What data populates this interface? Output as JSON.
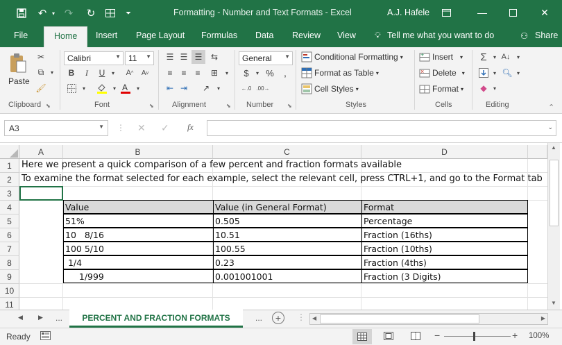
{
  "title_bar": {
    "document_title": "Formatting - Number and Text Formats  -  Excel",
    "user": "A.J. Hafele"
  },
  "ribbon_tabs": [
    "File",
    "Home",
    "Insert",
    "Page Layout",
    "Formulas",
    "Data",
    "Review",
    "View"
  ],
  "tell_me": "Tell me what you want to do",
  "share": "Share",
  "ribbon": {
    "font_name": "Calibri",
    "font_size": "11",
    "paste": "Paste",
    "number_format": "General",
    "conditional_formatting": "Conditional Formatting",
    "format_as_table": "Format as Table",
    "cell_styles": "Cell Styles",
    "insert": "Insert",
    "delete": "Delete",
    "format": "Format",
    "groups": {
      "clipboard": "Clipboard",
      "font": "Font",
      "alignment": "Alignment",
      "number": "Number",
      "styles": "Styles",
      "cells": "Cells",
      "editing": "Editing"
    },
    "bold": "B",
    "italic": "I",
    "underline": "U"
  },
  "formula_bar": {
    "name_box": "A3",
    "formula": ""
  },
  "columns": [
    "A",
    "B",
    "C",
    "D"
  ],
  "rows": [
    "1",
    "2",
    "3",
    "4",
    "5",
    "6",
    "7",
    "8",
    "9",
    "10",
    "11"
  ],
  "intro": {
    "row1": "Here we present a quick comparison of a few percent and fraction formats available",
    "row2": "To examine the format selected for each example, select the relevant cell, press CTRL+1, and go to the Format tab"
  },
  "table": {
    "headers": [
      "Value",
      "Value (in General Format)",
      "Format"
    ],
    "rows": [
      [
        "51%",
        "0.505",
        "Percentage"
      ],
      [
        "10   8/16",
        "10.51",
        "Fraction (16ths)"
      ],
      [
        "100 5/10",
        "100.55",
        "Fraction (10ths)"
      ],
      [
        " 1/4",
        "0.23",
        "Fraction (4ths)"
      ],
      [
        "     1/999",
        "0.001001001",
        "Fraction (3 Digits)"
      ]
    ]
  },
  "sheet_tab": "PERCENT AND FRACTION FORMATS",
  "status": {
    "ready": "Ready",
    "zoom": "100%"
  },
  "colors": {
    "excel_green": "#217346",
    "header_fill": "#d9d9d9"
  }
}
